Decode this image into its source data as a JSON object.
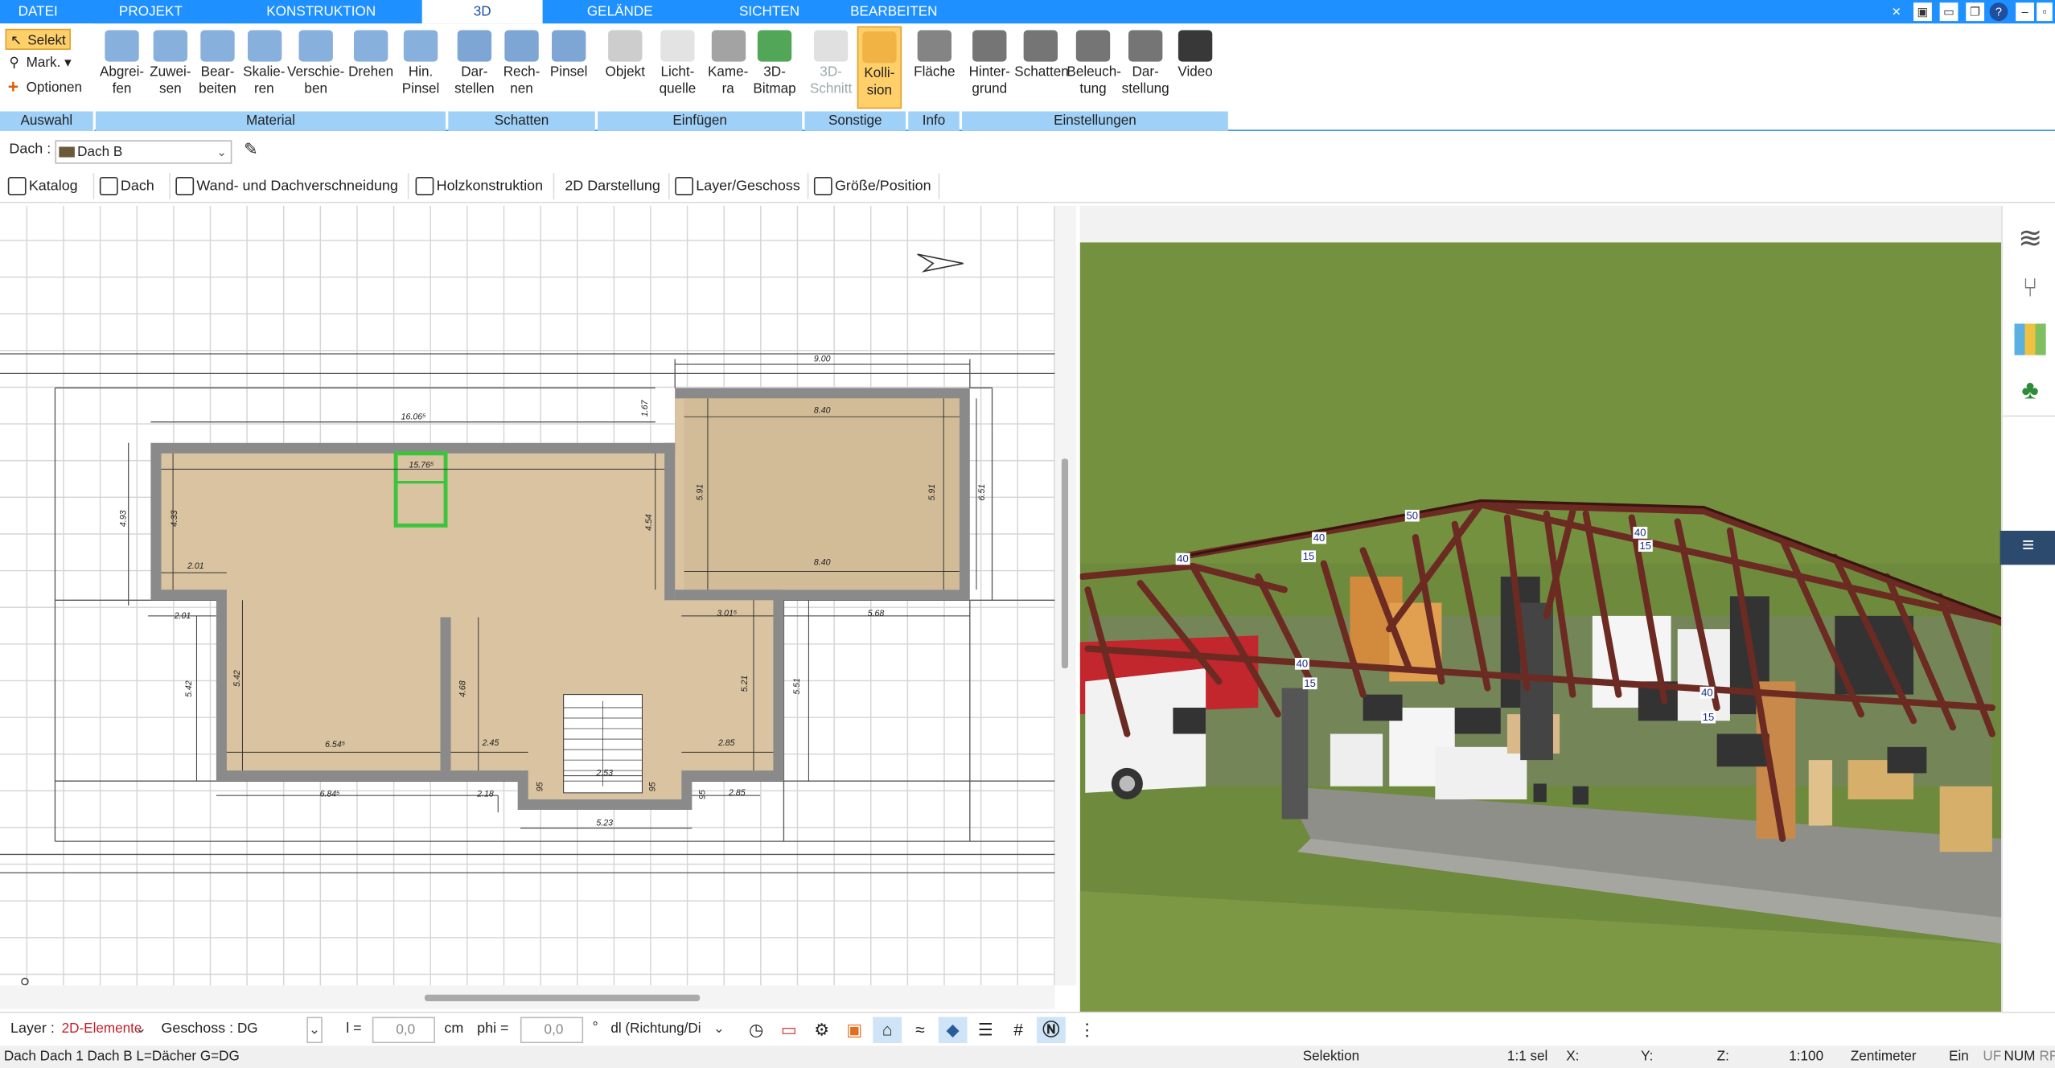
{
  "menu": {
    "tabs": [
      "DATEI",
      "PROJEKT",
      "KONSTRUKTION",
      "3D",
      "GELÄNDE",
      "SICHTEN",
      "BEARBEITEN"
    ],
    "active": "3D"
  },
  "ribbon": {
    "auswahl": {
      "label": "Auswahl",
      "selekt": "Selekt",
      "mark": "Mark.",
      "optionen": "Optionen"
    },
    "material": {
      "label": "Material",
      "buttons": [
        "Abgrei-\nfen",
        "Zuwei-\nsen",
        "Bear-\nbeiten",
        "Skalie-\nren",
        "Verschie-\nben",
        "Drehen",
        "Hin.\nPinsel"
      ]
    },
    "schatten": {
      "label": "Schatten",
      "buttons": [
        "Dar-\nstellen",
        "Rech-\nnen",
        "Pinsel"
      ]
    },
    "einfuegen": {
      "label": "Einfügen",
      "buttons": [
        "Objekt",
        "Licht-\nquelle",
        "Kame-\nra",
        "3D-\nBitmap"
      ]
    },
    "sonstige": {
      "label": "Sonstige",
      "buttons": [
        "3D-\nSchnitt",
        "Kolli-\nsion"
      ]
    },
    "info": {
      "label": "Info",
      "buttons": [
        "Fläche"
      ]
    },
    "einstellungen": {
      "label": "Einstellungen",
      "buttons": [
        "Hinter-\ngrund",
        "Schatten",
        "Beleuch-\ntung",
        "Dar-\nstellung",
        "Video"
      ]
    }
  },
  "propbar": {
    "label": "Dach :",
    "value": "Dach B"
  },
  "toolbar2": [
    "Katalog",
    "Dach",
    "Wand- und Dachverschneidung",
    "Holzkonstruktion",
    "2D Darstellung",
    "Layer/Geschoss",
    "Größe/Position"
  ],
  "plan": {
    "dims": {
      "total_top": "9.00",
      "d16": "16.06⁵",
      "d167": "1.67",
      "d840a": "8.40",
      "d840b": "8.40",
      "d1576": "15.76⁵",
      "d493": "4.93",
      "d433": "4.33",
      "d454": "4.54",
      "d591a": "5.91",
      "d591b": "5.91",
      "d651": "6.51",
      "d201a": "2.01",
      "d201b": "2.01",
      "d301": "3.01⁵",
      "d568": "5.68",
      "d542a": "5.42",
      "d542b": "5.42",
      "d468": "4.68",
      "d521": "5.21",
      "d551": "5.51",
      "d654": "6.54⁵",
      "d245": "2.45",
      "d285a": "2.85",
      "d253": "2.53",
      "d684": "6.84⁵",
      "d218": "2.18",
      "d95a": "95",
      "d95b": "95",
      "d95c": "95",
      "d285b": "2.85",
      "d523": "5.23"
    }
  },
  "view3d": {
    "labels": [
      "40",
      "15",
      "40",
      "50",
      "40",
      "40",
      "15",
      "40",
      "15",
      "15"
    ]
  },
  "bottom": {
    "layer_label": "Layer :",
    "layer_value": "2D-Elemente",
    "geschoss_label": "Geschoss :",
    "geschoss_value": "DG",
    "l_label": "l =",
    "l_value": "0,0",
    "l_unit": "cm",
    "phi_label": "phi =",
    "phi_value": "0,0",
    "phi_unit": "°",
    "dl_value": "dl (Richtung/Di"
  },
  "status": {
    "left": "Dach Dach 1 Dach B L=Dächer G=DG",
    "mode": "Selektion",
    "sel": "1:1 sel",
    "x": "X:",
    "y": "Y:",
    "z": "Z:",
    "scale": "1:100",
    "unit": "Zentimeter",
    "ein": "Ein",
    "uf": "UF",
    "num": "NUM",
    "rf": "RF"
  },
  "colors": {
    "accent": "#1e90ff",
    "group_label": "#9fd0f7",
    "wall": "#8a8a8a",
    "floor": "#d9c3a0",
    "grass": "#6e8a3c",
    "roof": "#6b2a22"
  }
}
